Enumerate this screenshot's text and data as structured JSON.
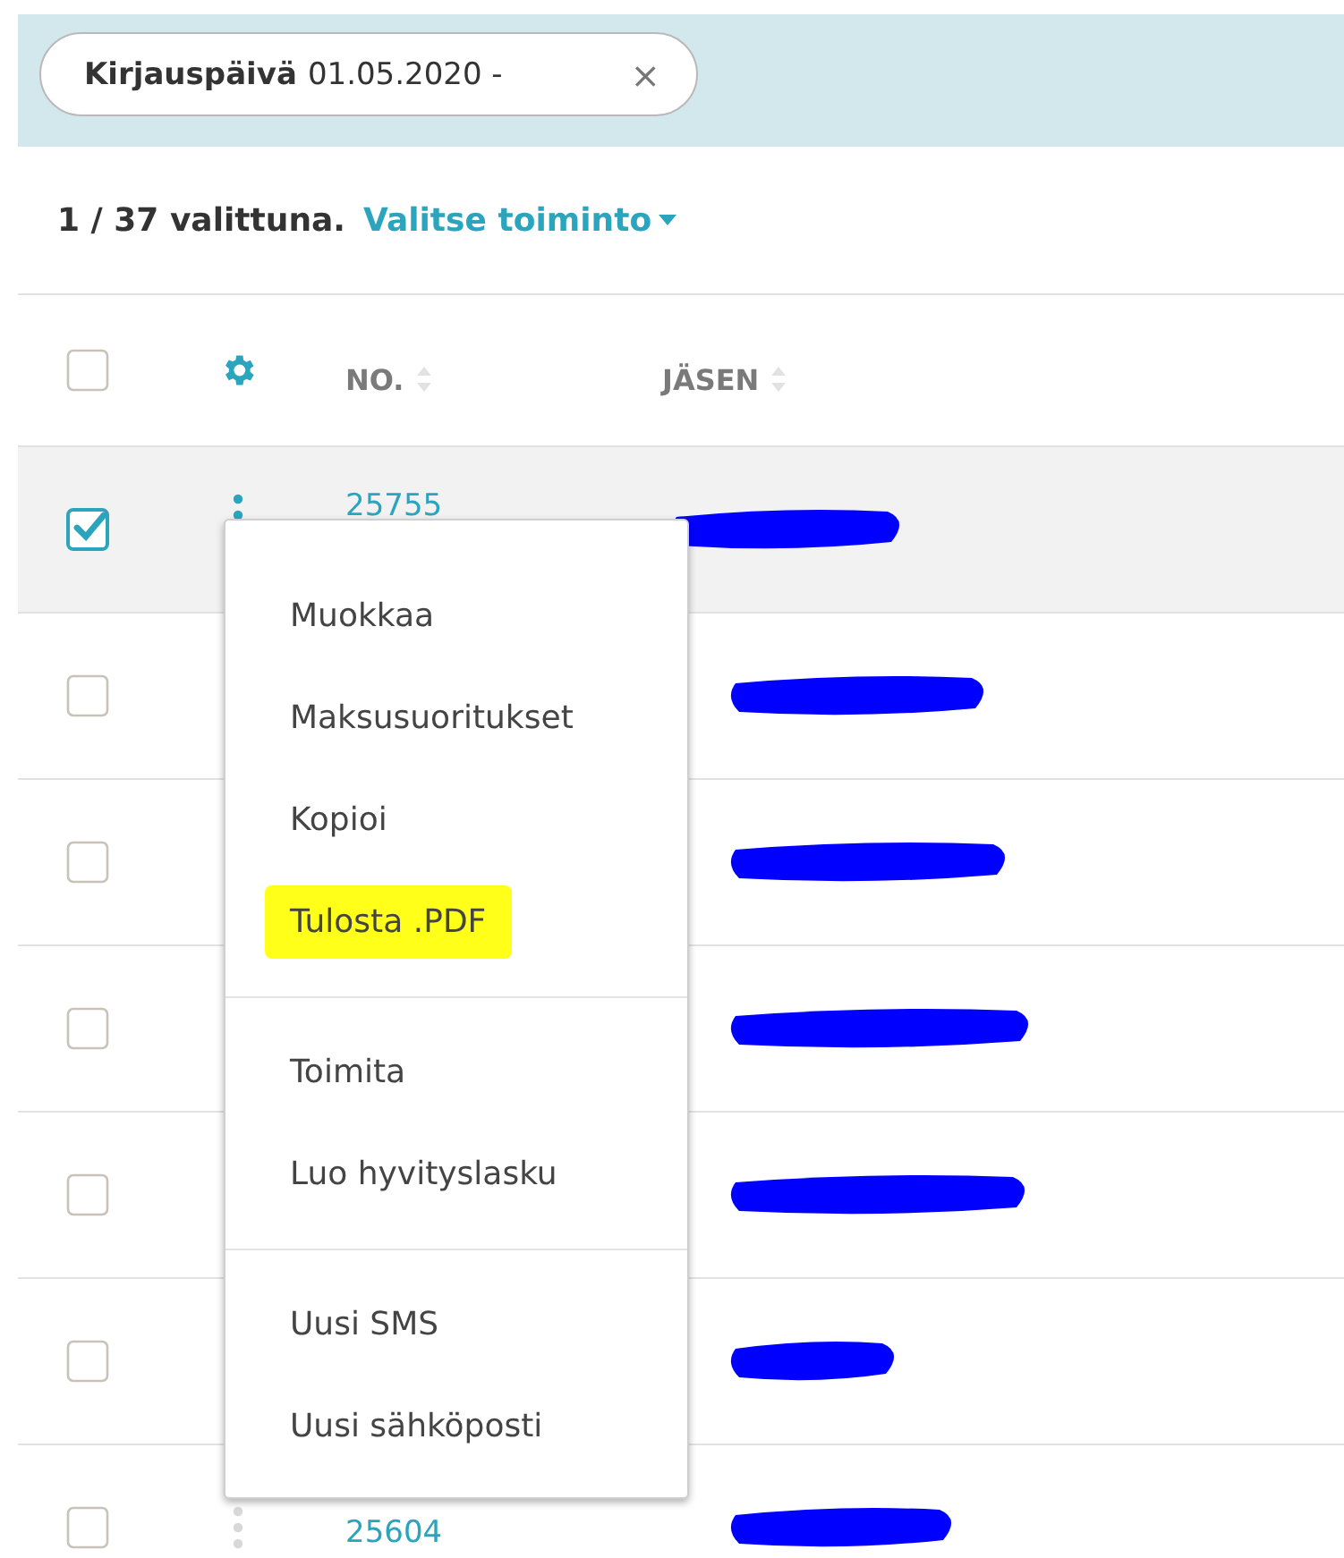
{
  "filter_chip": {
    "label": "Kirjauspäivä",
    "value": "01.05.2020 -",
    "close": "×"
  },
  "toolbar": {
    "selection": "1 / 37 valittuna.",
    "action": "Valitse toiminto"
  },
  "table": {
    "header_checked": false,
    "columns": [
      "NO.",
      "JÄSEN"
    ],
    "rows": [
      {
        "selected": true,
        "checked": true,
        "number": "25755",
        "member": {
          "kind": "redacted"
        }
      },
      {
        "selected": false,
        "checked": false,
        "member": {
          "kind": "redacted"
        }
      },
      {
        "selected": false,
        "checked": false,
        "member": {
          "kind": "redacted"
        }
      },
      {
        "selected": false,
        "checked": false,
        "member": {
          "kind": "redacted"
        }
      },
      {
        "selected": false,
        "checked": false,
        "member": {
          "kind": "redacted"
        }
      },
      {
        "selected": false,
        "checked": false,
        "member": {
          "kind": "redacted"
        }
      },
      {
        "selected": false,
        "checked": false,
        "number": "25604",
        "member": {
          "kind": "redacted"
        }
      }
    ]
  },
  "context_menu": {
    "sections": [
      {
        "items": [
          {
            "label": "Muokkaa",
            "highlighted": false
          },
          {
            "label": "Maksusuoritukset",
            "highlighted": false
          },
          {
            "label": "Kopioi",
            "highlighted": false
          },
          {
            "label": "Tulosta .PDF",
            "highlighted": true
          }
        ]
      },
      {
        "items": [
          {
            "label": "Toimita",
            "highlighted": false
          },
          {
            "label": "Luo hyvityslasku",
            "highlighted": false
          }
        ]
      },
      {
        "items": [
          {
            "label": "Uusi SMS",
            "highlighted": false
          },
          {
            "label": "Uusi sähköposti",
            "highlighted": false
          }
        ]
      }
    ]
  }
}
